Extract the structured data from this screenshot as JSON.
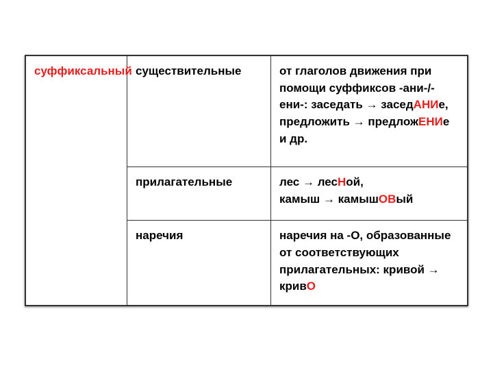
{
  "table": {
    "col1": "суффиксальный",
    "rows": [
      {
        "pos": "существительные",
        "ex_pre": "от глаголов движения при помощи суффиксов -ани-/-ени-: заседать → засед",
        "ex_hl1": "АНИ",
        "ex_mid": "е, предложить → предлож",
        "ex_hl2": "ЕНИ",
        "ex_post": "е и др."
      },
      {
        "pos": "прилагательные",
        "ex_pre": "лес → лес",
        "ex_hl1": "Н",
        "ex_mid": "ой,",
        "ex_br": "камыш → камыш",
        "ex_hl2": "ОВ",
        "ex_post": "ый"
      },
      {
        "pos": "наречия",
        "ex_pre": "наречия на -О, образованные от соответствующих прилагательных: кривой → крив",
        "ex_hl1": "О"
      }
    ]
  }
}
